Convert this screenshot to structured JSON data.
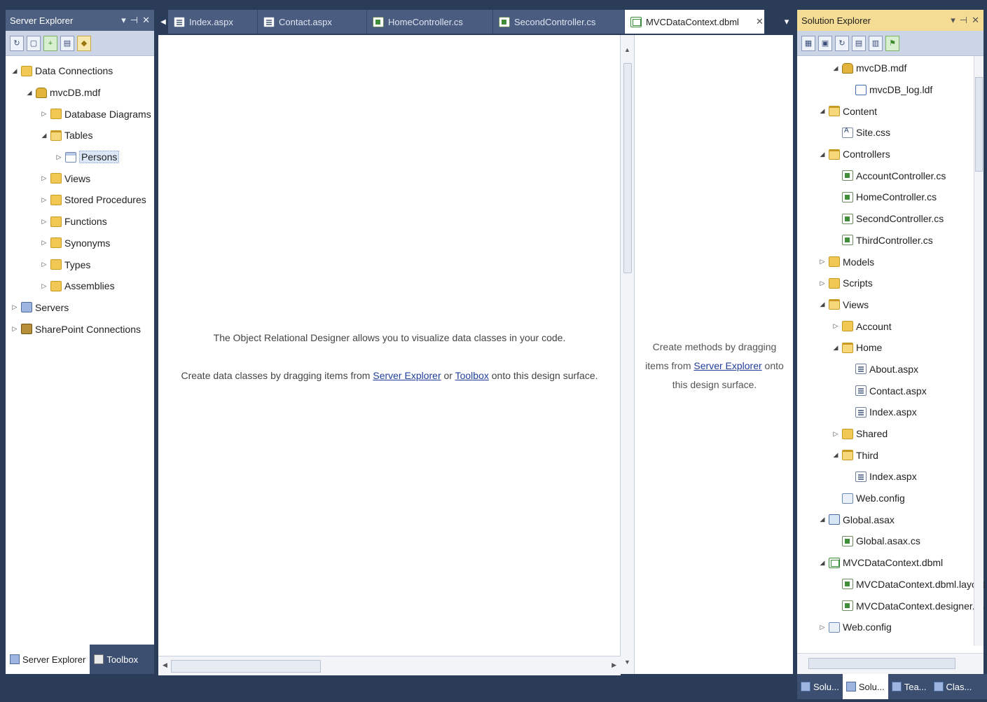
{
  "server_explorer": {
    "title": "Server Explorer",
    "controls": [
      "▾",
      "⊣",
      "✕"
    ],
    "tree": [
      {
        "depth": 0,
        "toggle": "◢",
        "icon": "folder",
        "icon_name": "data-connections-icon",
        "label": "Data Connections"
      },
      {
        "depth": 1,
        "toggle": "◢",
        "icon": "db",
        "icon_name": "database-icon",
        "label": "mvcDB.mdf"
      },
      {
        "depth": 2,
        "toggle": "▷",
        "icon": "folder",
        "icon_name": "folder-icon",
        "label": "Database Diagrams"
      },
      {
        "depth": 2,
        "toggle": "◢",
        "icon": "folder-open",
        "icon_name": "folder-open-icon",
        "label": "Tables"
      },
      {
        "depth": 3,
        "toggle": "▷",
        "icon": "table",
        "icon_name": "table-icon",
        "label": "Persons",
        "selected": true
      },
      {
        "depth": 2,
        "toggle": "▷",
        "icon": "folder",
        "icon_name": "folder-icon",
        "label": "Views"
      },
      {
        "depth": 2,
        "toggle": "▷",
        "icon": "folder",
        "icon_name": "folder-icon",
        "label": "Stored Procedures"
      },
      {
        "depth": 2,
        "toggle": "▷",
        "icon": "folder",
        "icon_name": "folder-icon",
        "label": "Functions"
      },
      {
        "depth": 2,
        "toggle": "▷",
        "icon": "folder",
        "icon_name": "folder-icon",
        "label": "Synonyms"
      },
      {
        "depth": 2,
        "toggle": "▷",
        "icon": "folder",
        "icon_name": "folder-icon",
        "label": "Types"
      },
      {
        "depth": 2,
        "toggle": "▷",
        "icon": "folder",
        "icon_name": "folder-icon",
        "label": "Assemblies"
      },
      {
        "depth": 0,
        "toggle": "▷",
        "icon": "server",
        "icon_name": "servers-icon",
        "label": "Servers"
      },
      {
        "depth": 0,
        "toggle": "▷",
        "icon": "sharepoint",
        "icon_name": "sharepoint-icon",
        "label": "SharePoint Connections"
      }
    ],
    "bottom_tabs": [
      {
        "label": "Server Explorer",
        "active": true,
        "icon": "server"
      },
      {
        "label": "Toolbox",
        "active": false,
        "icon": "tool"
      }
    ]
  },
  "doc_tabs": [
    {
      "label": "Index.aspx",
      "icon": "aspx",
      "active": false
    },
    {
      "label": "Contact.aspx",
      "icon": "aspx",
      "active": false
    },
    {
      "label": "HomeController.cs",
      "icon": "cs",
      "active": false
    },
    {
      "label": "SecondController.cs",
      "icon": "cs",
      "active": false
    },
    {
      "label": "MVCDataContext.dbml",
      "icon": "dbml",
      "active": true
    }
  ],
  "designer": {
    "message_line1": "The Object Relational Designer allows you to visualize data classes in your code.",
    "message_line2_prefix": "Create data classes by dragging items from ",
    "server_explorer_link": "Server Explorer",
    "or_text": " or ",
    "toolbox_link": "Toolbox",
    "message_line2_suffix": " onto this design surface.",
    "method_prefix": "Create methods by dragging items from ",
    "method_link": "Server Explorer",
    "method_suffix": " onto this design surface."
  },
  "solution_explorer": {
    "title": "Solution Explorer",
    "controls": [
      "▾",
      "⊣",
      "✕"
    ],
    "tree": [
      {
        "depth": 2,
        "toggle": "◢",
        "icon": "db",
        "icon_name": "database-icon",
        "label": "mvcDB.mdf"
      },
      {
        "depth": 3,
        "toggle": "",
        "icon": "ldf",
        "icon_name": "log-file-icon",
        "label": "mvcDB_log.ldf"
      },
      {
        "depth": 1,
        "toggle": "◢",
        "icon": "folder-open",
        "icon_name": "folder-open-icon",
        "label": "Content"
      },
      {
        "depth": 2,
        "toggle": "",
        "icon": "css",
        "icon_name": "stylesheet-icon",
        "label": "Site.css"
      },
      {
        "depth": 1,
        "toggle": "◢",
        "icon": "folder-open",
        "icon_name": "folder-open-icon",
        "label": "Controllers"
      },
      {
        "depth": 2,
        "toggle": "",
        "icon": "cs",
        "icon_name": "csharp-file-icon",
        "label": "AccountController.cs"
      },
      {
        "depth": 2,
        "toggle": "",
        "icon": "cs",
        "icon_name": "csharp-file-icon",
        "label": "HomeController.cs"
      },
      {
        "depth": 2,
        "toggle": "",
        "icon": "cs",
        "icon_name": "csharp-file-icon",
        "label": "SecondController.cs"
      },
      {
        "depth": 2,
        "toggle": "",
        "icon": "cs",
        "icon_name": "csharp-file-icon",
        "label": "ThirdController.cs"
      },
      {
        "depth": 1,
        "toggle": "▷",
        "icon": "folder",
        "icon_name": "folder-icon",
        "label": "Models"
      },
      {
        "depth": 1,
        "toggle": "▷",
        "icon": "folder",
        "icon_name": "folder-icon",
        "label": "Scripts"
      },
      {
        "depth": 1,
        "toggle": "◢",
        "icon": "folder-open",
        "icon_name": "folder-open-icon",
        "label": "Views"
      },
      {
        "depth": 2,
        "toggle": "▷",
        "icon": "folder",
        "icon_name": "folder-icon",
        "label": "Account"
      },
      {
        "depth": 2,
        "toggle": "◢",
        "icon": "folder-open",
        "icon_name": "folder-open-icon",
        "label": "Home"
      },
      {
        "depth": 3,
        "toggle": "",
        "icon": "aspx",
        "icon_name": "aspx-file-icon",
        "label": "About.aspx"
      },
      {
        "depth": 3,
        "toggle": "",
        "icon": "aspx",
        "icon_name": "aspx-file-icon",
        "label": "Contact.aspx"
      },
      {
        "depth": 3,
        "toggle": "",
        "icon": "aspx",
        "icon_name": "aspx-file-icon",
        "label": "Index.aspx"
      },
      {
        "depth": 2,
        "toggle": "▷",
        "icon": "folder",
        "icon_name": "folder-icon",
        "label": "Shared"
      },
      {
        "depth": 2,
        "toggle": "◢",
        "icon": "folder-open",
        "icon_name": "folder-open-icon",
        "label": "Third"
      },
      {
        "depth": 3,
        "toggle": "",
        "icon": "aspx",
        "icon_name": "aspx-file-icon",
        "label": "Index.aspx"
      },
      {
        "depth": 2,
        "toggle": "",
        "icon": "config",
        "icon_name": "config-file-icon",
        "label": "Web.config"
      },
      {
        "depth": 1,
        "toggle": "◢",
        "icon": "asax",
        "icon_name": "asax-file-icon",
        "label": "Global.asax"
      },
      {
        "depth": 2,
        "toggle": "",
        "icon": "cs",
        "icon_name": "csharp-file-icon",
        "label": "Global.asax.cs"
      },
      {
        "depth": 1,
        "toggle": "◢",
        "icon": "dbml",
        "icon_name": "dbml-file-icon",
        "label": "MVCDataContext.dbml"
      },
      {
        "depth": 2,
        "toggle": "",
        "icon": "cs",
        "icon_name": "layout-file-icon",
        "label": "MVCDataContext.dbml.layout"
      },
      {
        "depth": 2,
        "toggle": "",
        "icon": "cs",
        "icon_name": "csharp-file-icon",
        "label": "MVCDataContext.designer.cs"
      },
      {
        "depth": 1,
        "toggle": "▷",
        "icon": "config",
        "icon_name": "config-file-icon",
        "label": "Web.config"
      }
    ],
    "bottom_tabs": [
      {
        "label": "Solu...",
        "active": false
      },
      {
        "label": "Solu...",
        "active": true
      },
      {
        "label": "Tea...",
        "active": false
      },
      {
        "label": "Clas...",
        "active": false
      }
    ]
  }
}
